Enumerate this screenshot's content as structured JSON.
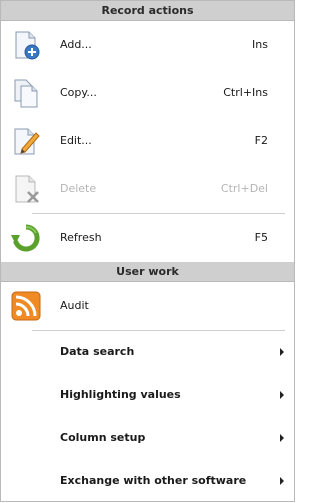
{
  "record_actions": {
    "header": "Record actions",
    "items": [
      {
        "label": "Add...",
        "shortcut": "Ins",
        "icon": "add-document-icon",
        "enabled": true
      },
      {
        "label": "Copy...",
        "shortcut": "Ctrl+Ins",
        "icon": "copy-document-icon",
        "enabled": true
      },
      {
        "label": "Edit...",
        "shortcut": "F2",
        "icon": "edit-document-icon",
        "enabled": true
      },
      {
        "label": "Delete",
        "shortcut": "Ctrl+Del",
        "icon": "delete-document-icon",
        "enabled": false
      },
      {
        "label": "Refresh",
        "shortcut": "F5",
        "icon": "refresh-icon",
        "enabled": true
      }
    ]
  },
  "user_work": {
    "header": "User work",
    "audit": {
      "label": "Audit",
      "icon": "rss-feed-icon"
    },
    "submenus": [
      {
        "label": "Data search"
      },
      {
        "label": "Highlighting values"
      },
      {
        "label": "Column setup"
      },
      {
        "label": "Exchange with other software"
      }
    ]
  },
  "colors": {
    "header_bg": "#cfcfcf",
    "disabled_text": "#b5b5b5",
    "accent_blue": "#3b78c4",
    "refresh_green": "#5aa02c",
    "rss_orange": "#f08a24"
  }
}
